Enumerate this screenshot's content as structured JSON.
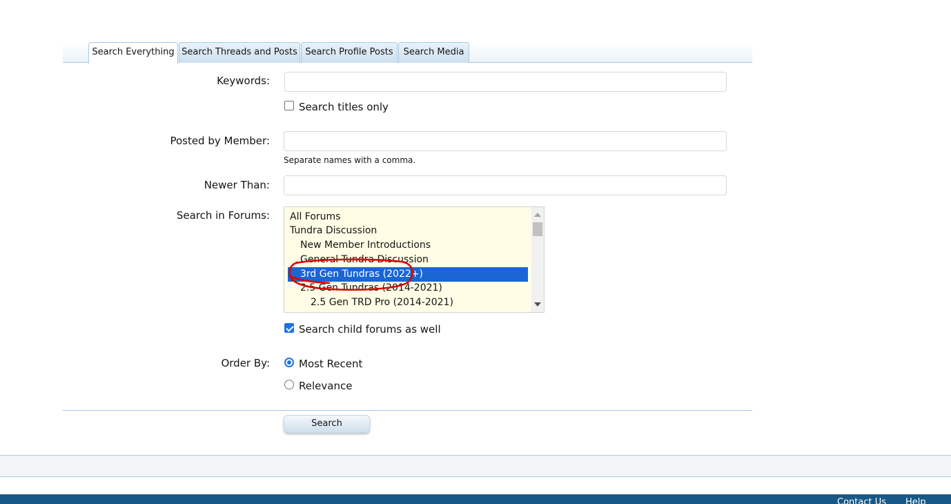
{
  "tabs": [
    {
      "label": "Search Everything",
      "active": true
    },
    {
      "label": "Search Threads and Posts",
      "active": false
    },
    {
      "label": "Search Profile Posts",
      "active": false
    },
    {
      "label": "Search Media",
      "active": false
    }
  ],
  "form": {
    "keywords_label": "Keywords:",
    "keywords_value": "",
    "titles_only_label": "Search titles only",
    "titles_only_checked": false,
    "member_label": "Posted by Member:",
    "member_value": "",
    "member_hint": "Separate names with a comma.",
    "newer_label": "Newer Than:",
    "newer_value": "",
    "forums_label": "Search in Forums:",
    "forums": [
      {
        "label": "All Forums",
        "level": 0,
        "selected": false
      },
      {
        "label": "Tundra Discussion",
        "level": 0,
        "selected": false
      },
      {
        "label": "New Member Introductions",
        "level": 1,
        "selected": false
      },
      {
        "label": "General Tundra Discussion",
        "level": 1,
        "selected": false
      },
      {
        "label": "3rd Gen Tundras (2022+)",
        "level": 1,
        "selected": true
      },
      {
        "label": "2.5 Gen Tundras (2014-2021)",
        "level": 1,
        "selected": false
      },
      {
        "label": "2.5 Gen TRD Pro (2014-2021)",
        "level": 2,
        "selected": false
      }
    ],
    "child_forums_label": "Search child forums as well",
    "child_forums_checked": true,
    "order_label": "Order By:",
    "order_options": [
      {
        "label": "Most Recent",
        "checked": true
      },
      {
        "label": "Relevance",
        "checked": false
      }
    ],
    "submit_label": "Search"
  },
  "annotation": {
    "color": "#e00000"
  },
  "footer": {
    "links": [
      "Contact Us",
      "Help"
    ]
  },
  "colors": {
    "accent": "#1a66d2",
    "footer": "#185886",
    "border": "#a5cae4"
  }
}
